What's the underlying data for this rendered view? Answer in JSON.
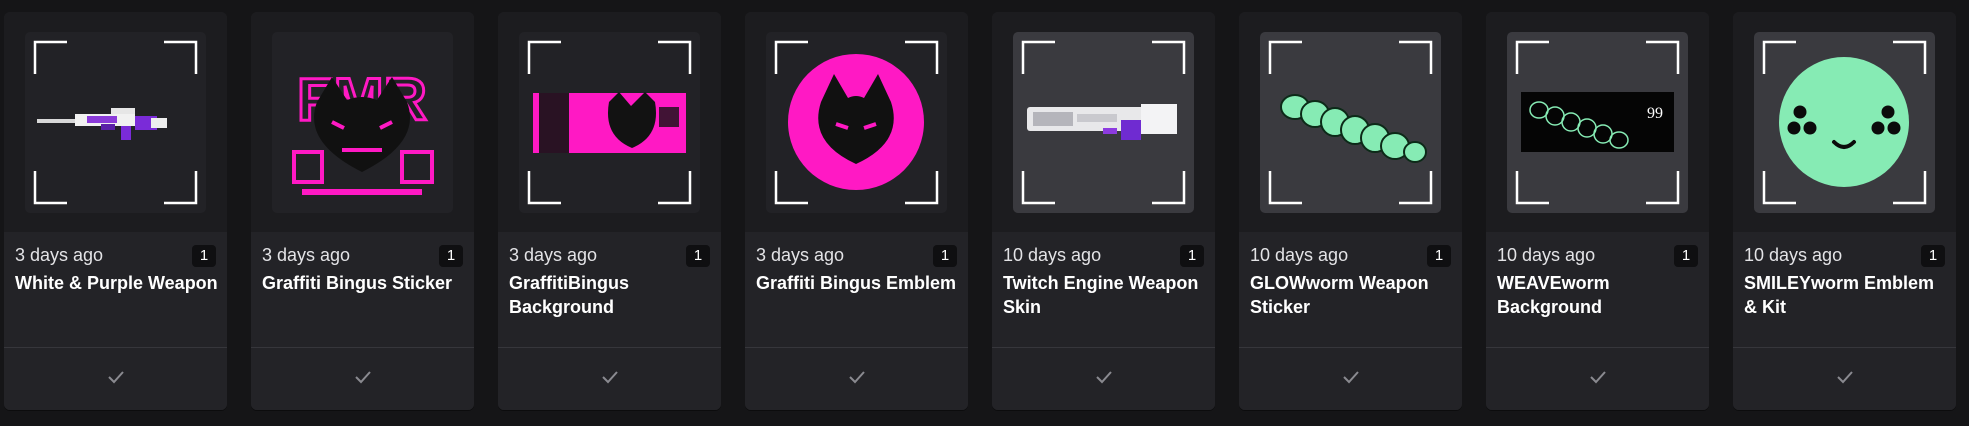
{
  "items": [
    {
      "date": "3 days ago",
      "qty": "1",
      "title": "White & Purple Weapon",
      "thumb": "white-purple-rifle"
    },
    {
      "date": "3 days ago",
      "qty": "1",
      "title": "Graffiti Bingus Sticker",
      "thumb": "graffiti-cat-sticker"
    },
    {
      "date": "3 days ago",
      "qty": "1",
      "title": "GraffitiBingus Background",
      "thumb": "graffiti-cat-banner"
    },
    {
      "date": "3 days ago",
      "qty": "1",
      "title": "Graffiti Bingus Emblem",
      "thumb": "pink-cat-emblem"
    },
    {
      "date": "10 days ago",
      "qty": "1",
      "title": "Twitch Engine Weapon Skin",
      "thumb": "twitch-engine-rifle"
    },
    {
      "date": "10 days ago",
      "qty": "1",
      "title": "GLOWworm Weapon Sticker",
      "thumb": "glowworm"
    },
    {
      "date": "10 days ago",
      "qty": "1",
      "title": "WEAVEworm Background",
      "thumb": "weaveworm-banner"
    },
    {
      "date": "10 days ago",
      "qty": "1",
      "title": "SMILEYworm Emblem & Kit",
      "thumb": "smiley-face"
    }
  ],
  "banner_number": "99",
  "sticker_letters": "FMR",
  "colors": {
    "accent_pink": "#ff19c4",
    "worm_green": "#86ebb4",
    "purple": "#7a2bd8"
  }
}
